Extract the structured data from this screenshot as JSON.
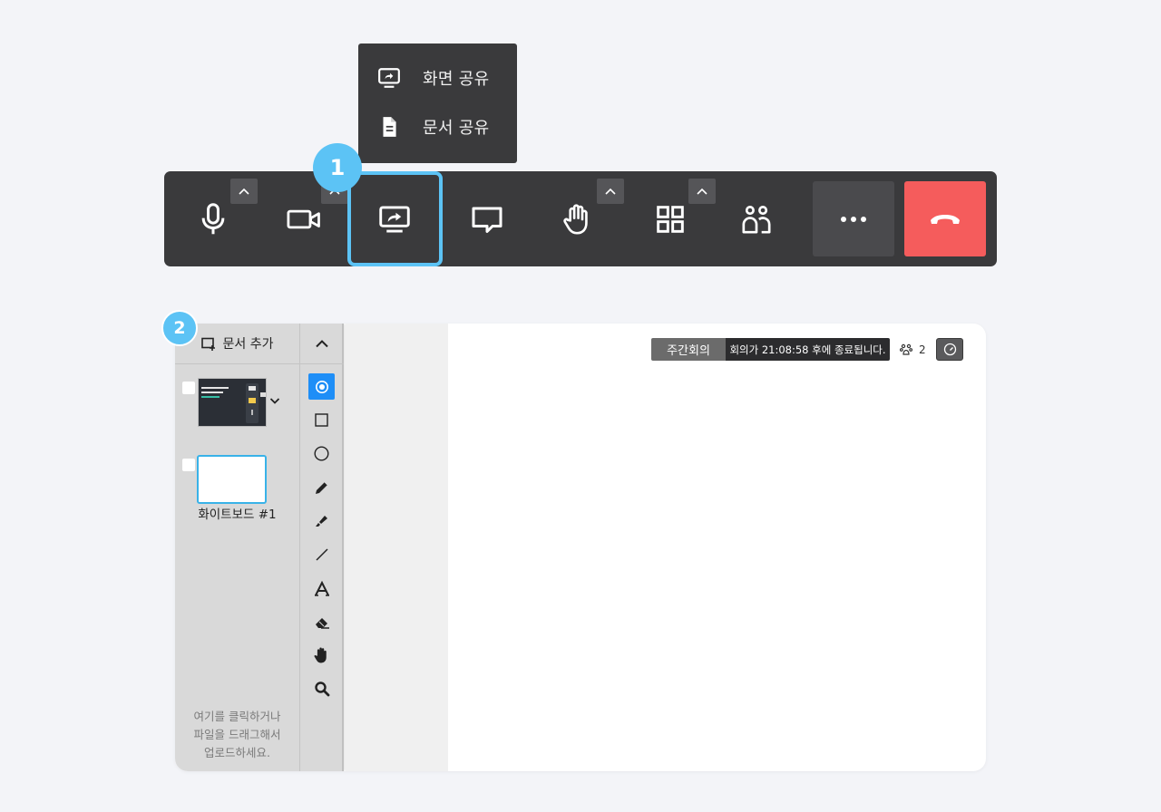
{
  "share_menu": {
    "screen_share_label": "화면 공유",
    "screen_share_icon": "screen-share-icon",
    "doc_share_label": "문서 공유",
    "doc_share_icon": "document-icon"
  },
  "badges": {
    "step1": "1",
    "step2": "2"
  },
  "toolbar": {
    "buttons": [
      "microphone-icon",
      "camera-icon",
      "screen-share-icon",
      "chat-icon",
      "raise-hand-icon",
      "layout-grid-icon",
      "participants-icon",
      "more-icon",
      "end-call-icon"
    ],
    "accent_color": "#5cc3f5",
    "end_call_color": "#f55c5c"
  },
  "doc_panel": {
    "add_label": "문서 추가",
    "add_icon": "add-document-icon",
    "whiteboard_caption": "화이트보드 #1",
    "hint_lines": [
      "여기를 클릭하거나",
      "파일을 드래그해서",
      "업로드하세요."
    ]
  },
  "tools": [
    "pointer-icon",
    "rectangle-icon",
    "circle-icon",
    "pen-icon",
    "highlighter-icon",
    "line-icon",
    "text-icon",
    "eraser-icon",
    "hand-icon",
    "zoom-icon"
  ],
  "meeting": {
    "title": "주간회의",
    "timer_text": "회의가 21:08:58 후에 종료됩니다.",
    "participant_count": "2",
    "participants_icon": "paw-icon",
    "speed_icon": "gauge-icon"
  }
}
